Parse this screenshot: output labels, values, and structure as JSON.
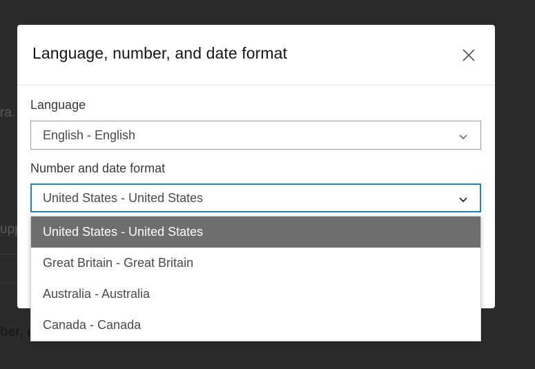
{
  "modal": {
    "title": "Language, number, and date format",
    "close_icon": "close-icon"
  },
  "language": {
    "label": "Language",
    "value": "English - English"
  },
  "format": {
    "label": "Number and date format",
    "value": "United States - United States",
    "options": [
      "United States - United States",
      "Great Britain - Great Britain",
      "Australia - Australia",
      "Canada - Canada"
    ],
    "selected_index": 0
  },
  "background": {
    "frag1": "ra.",
    "frag2": "upp",
    "frag3": "ber, d"
  },
  "colors": {
    "focus": "#2a7fb3",
    "selected_option_bg": "#6e6e6e",
    "overlay": "#2b2b2b"
  }
}
